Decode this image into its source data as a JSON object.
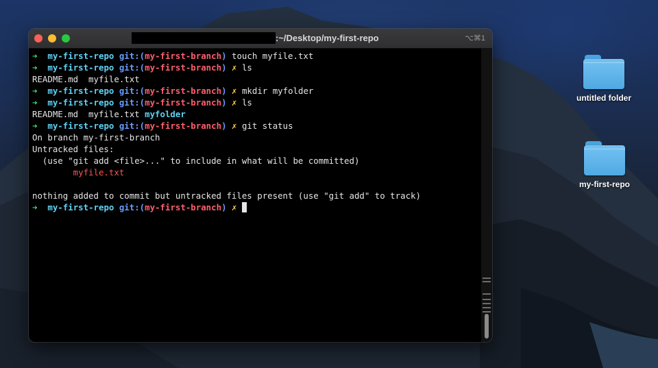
{
  "window": {
    "title": ":~/Desktop/my-first-repo",
    "shortcut": "⌥⌘1"
  },
  "prompt": {
    "arrow": "➜",
    "repo": "my-first-repo",
    "git_prefix": "git:(",
    "branch": "my-first-branch",
    "git_suffix": ")",
    "dirty": "✗"
  },
  "terminal": {
    "commands": [
      "touch myfile.txt",
      "ls",
      "mkdir myfolder",
      "ls",
      "git status"
    ],
    "ls1_output": "README.md  myfile.txt",
    "ls2_files": "README.md  myfile.txt ",
    "ls2_folder": "myfolder",
    "status_lines": [
      "On branch my-first-branch",
      "Untracked files:",
      "  (use \"git add <file>...\" to include in what will be committed)"
    ],
    "untracked_file": "        myfile.txt",
    "summary": "nothing added to commit but untracked files present (use \"git add\" to track)"
  },
  "desktop": {
    "icons": [
      {
        "label": "untitled folder",
        "icon": "folder-icon"
      },
      {
        "label": "my-first-repo",
        "icon": "folder-icon"
      }
    ]
  },
  "colors": {
    "arrow": "#34e27c",
    "repo": "#5fd3f6",
    "git": "#6a9cff",
    "branch": "#ff5f6d",
    "dirty": "#ffd23f",
    "untracked": "#ff5454"
  }
}
